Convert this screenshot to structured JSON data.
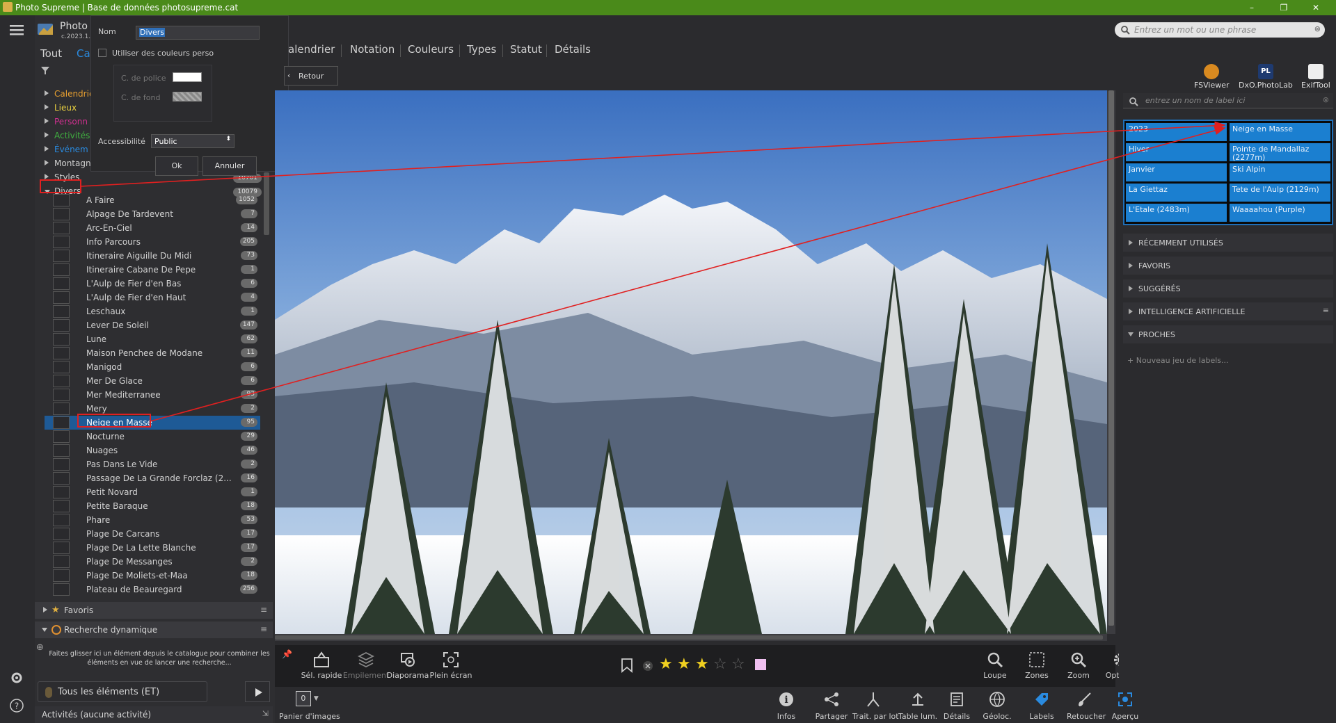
{
  "window": {
    "title": "Photo Supreme | Base de données photosupreme.cat",
    "min": "–",
    "max": "❐",
    "close": "✕"
  },
  "logo": {
    "name": "Photo",
    "version": "c.2023.1."
  },
  "left_tabs": {
    "all": "Tout",
    "cat": "Ca"
  },
  "tree_roots": [
    {
      "label": "Calendrier",
      "color": "#e8a030"
    },
    {
      "label": "Lieux",
      "color": "#e8d040"
    },
    {
      "label": "Personn",
      "color": "#d03090"
    },
    {
      "label": "Activités",
      "color": "#40b040"
    },
    {
      "label": "Événem",
      "color": "#2a8be0"
    },
    {
      "label": "Montagne",
      "color": "#cfcfcf"
    },
    {
      "label": "Styles",
      "color": "#cfcfcf",
      "count": "10701"
    },
    {
      "label": "Divers",
      "color": "#cfcfcf",
      "count": "10079"
    }
  ],
  "items": [
    {
      "name": "A Faire",
      "count": "1052"
    },
    {
      "name": "Alpage De Tardevent",
      "count": "7"
    },
    {
      "name": "Arc-En-Ciel",
      "count": "14"
    },
    {
      "name": "Info Parcours",
      "count": "205"
    },
    {
      "name": "Itineraire Aiguille Du Midi",
      "count": "73"
    },
    {
      "name": "Itineraire Cabane De Pepe",
      "count": "1"
    },
    {
      "name": "L'Aulp de Fier d'en Bas",
      "count": "6"
    },
    {
      "name": "L'Aulp de Fier d'en Haut",
      "count": "4"
    },
    {
      "name": "Leschaux",
      "count": "1"
    },
    {
      "name": "Lever De Soleil",
      "count": "147"
    },
    {
      "name": "Lune",
      "count": "62"
    },
    {
      "name": "Maison Penchee de Modane",
      "count": "11"
    },
    {
      "name": "Manigod",
      "count": "6"
    },
    {
      "name": "Mer De Glace",
      "count": "6"
    },
    {
      "name": "Mer Mediterranee",
      "count": "93"
    },
    {
      "name": "Mery",
      "count": "2"
    },
    {
      "name": "Neige en Masse",
      "count": "95"
    },
    {
      "name": "Nocturne",
      "count": "29"
    },
    {
      "name": "Nuages",
      "count": "46"
    },
    {
      "name": "Pas Dans Le Vide",
      "count": "2"
    },
    {
      "name": "Passage De La Grande Forclaz (2...",
      "count": "16"
    },
    {
      "name": "Petit Novard",
      "count": "1"
    },
    {
      "name": "Petite Baraque",
      "count": "18"
    },
    {
      "name": "Phare",
      "count": "53"
    },
    {
      "name": "Plage De Carcans",
      "count": "17"
    },
    {
      "name": "Plage De La Lette Blanche",
      "count": "17"
    },
    {
      "name": "Plage De Messanges",
      "count": "2"
    },
    {
      "name": "Plage De Moliets-et-Maa",
      "count": "18"
    },
    {
      "name": "Plateau de Beauregard",
      "count": "256"
    }
  ],
  "selected_index": 16,
  "popup": {
    "nom_label": "Nom",
    "nom_value": "Divers",
    "custom_colors": "Utiliser des couleurs perso",
    "font_color": "C. de police",
    "bg_color": "C. de fond",
    "access_label": "Accessibilité",
    "access_value": "Public",
    "ok": "Ok",
    "cancel": "Annuler"
  },
  "left_sections": {
    "favoris": "Favoris",
    "recherche": "Recherche dynamique",
    "drop_hint_1": "Faites glisser ici un élément depuis le catalogue pour combiner les",
    "drop_hint_2": "éléments en vue de lancer une recherche...",
    "all_items": "Tous les éléments (ET)",
    "activites": "Activités (aucune activité)"
  },
  "center_tabs": [
    "alendrier",
    "Notation",
    "Couleurs",
    "Types",
    "Statut",
    "Détails"
  ],
  "back": "Retour",
  "image_toolbar": {
    "sel_rapide": "Sél. rapide",
    "empilement": "Empilement",
    "diaporama": "Diaporama",
    "plein_ecran": "Plein écran",
    "loupe": "Loupe",
    "zones": "Zones",
    "zoom": "Zoom",
    "options": "Options",
    "rating": 3,
    "rating_max": 5
  },
  "bottom_bar": {
    "panier": "Panier d'images",
    "panier_count": "0",
    "infos": "Infos",
    "partager": "Partager",
    "trait": "Trait. par lot",
    "table": "Table lum.",
    "details": "Détails",
    "geoloc": "Géoloc.",
    "labels": "Labels",
    "retoucher": "Retoucher",
    "apercu": "Aperçu"
  },
  "right": {
    "search_placeholder": "Entrez un mot ou une phrase",
    "plugins": [
      "FSViewer",
      "DxO.PhotoLab",
      "ExifTool"
    ],
    "label_search_placeholder": "entrez un nom de label ici",
    "labels_left": [
      "2023",
      "Hiver",
      "Janvier",
      "La Giettaz",
      "L'Etale (2483m)"
    ],
    "labels_right": [
      "Neige en Masse",
      "Pointe de Mandallaz (2277m)",
      "Ski Alpin",
      "Tete de l'Aulp (2129m)",
      "Waaaahou (Purple)"
    ],
    "sections": [
      "RÉCEMMENT UTILISÉS",
      "FAVORIS",
      "SUGGÉRÉS",
      "INTELLIGENCE ARTIFICIELLE",
      "PROCHES"
    ],
    "new_set": "Nouveau jeu de labels..."
  },
  "colors": {
    "titlebar": "#4a8a1a",
    "selection": "#1e5a96",
    "label_cell": "#1b7fd0",
    "annotation": "#e02020",
    "star": "#f0d020"
  }
}
